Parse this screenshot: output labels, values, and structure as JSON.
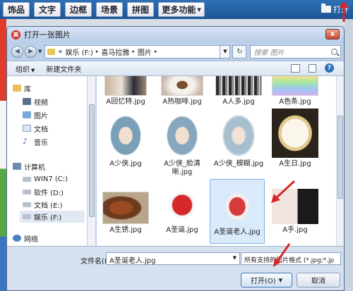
{
  "app": {
    "tabs": [
      "饰品",
      "文字",
      "边框",
      "场景",
      "拼图",
      "更多功能"
    ],
    "open_label": "打开"
  },
  "dialog": {
    "title": "打开一张图片",
    "close_glyph": "x",
    "breadcrumb": [
      "«",
      "娱乐 (F:)",
      "喜马拉雅",
      "图片"
    ],
    "search_placeholder": "搜索 图片",
    "toolbar": {
      "organize": "组织",
      "new_folder": "新建文件夹"
    },
    "nav": {
      "library": "库",
      "videos": "视频",
      "pictures": "图片",
      "documents": "文档",
      "music": "音乐",
      "computer": "计算机",
      "drive_c": "WIN7 (C:)",
      "drive_d": "软件 (D:)",
      "drive_e": "文档 (E:)",
      "drive_f": "娱乐 (F:)",
      "network": "网络"
    },
    "files": [
      {
        "name": "A回忆特.jpg"
      },
      {
        "name": "A热咖啡.jpg"
      },
      {
        "name": "A人多.jpg"
      },
      {
        "name": "A色条.jpg"
      },
      {
        "name": "A少侠.jpg"
      },
      {
        "name": "A少侠_脸清晰.jpg"
      },
      {
        "name": "A少侠_模糊.jpg"
      },
      {
        "name": "A生日.jpg"
      },
      {
        "name": "A生锈.jpg"
      },
      {
        "name": "A圣诞.jpg"
      },
      {
        "name": "A圣诞老人.jpg",
        "selected": true
      },
      {
        "name": "A手.jpg"
      }
    ],
    "filename_label": "文件名(N):",
    "filename_value": "A圣诞老人.jpg",
    "filetype_value": "所有支持的图片格式 (*.jpg;*.jp",
    "open_button": "打开(O)",
    "cancel_button": "取消"
  },
  "colors": {
    "annotation_arrow": "#d8262a",
    "selection": "#d9eafb"
  }
}
